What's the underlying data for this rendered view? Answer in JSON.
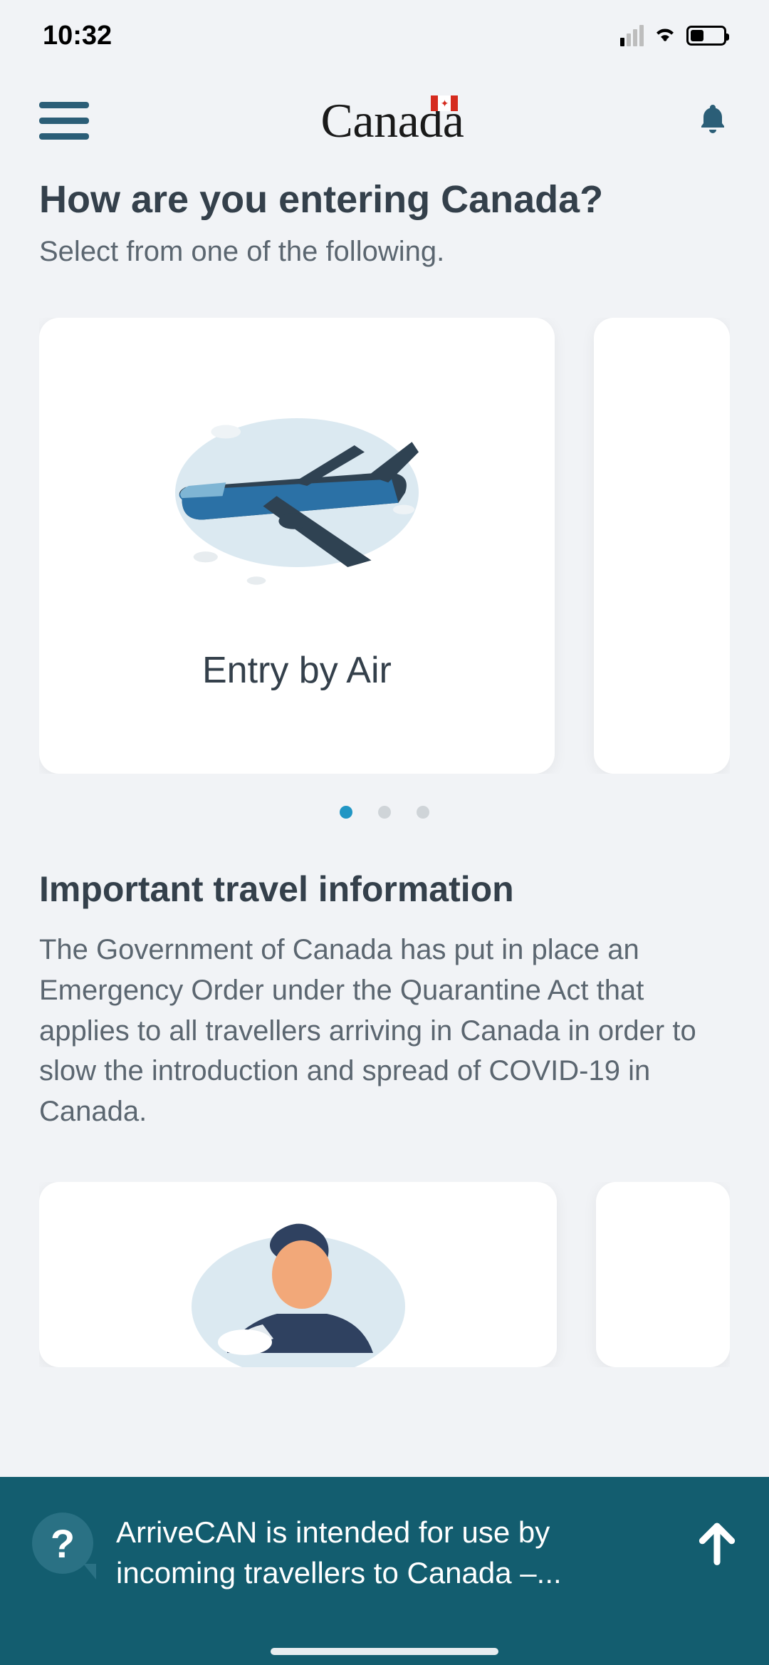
{
  "status": {
    "time": "10:32"
  },
  "header": {
    "wordmark": "Canada"
  },
  "question": {
    "title": "How are you entering Canada?",
    "subtitle": "Select from one of the following."
  },
  "entry_options": [
    {
      "label": "Entry by Air"
    }
  ],
  "carousel": {
    "total_dots": 3,
    "active_index": 0
  },
  "info": {
    "heading": "Important travel information",
    "body": "The Government of Canada has put in place an Emergency Order under the Quarantine Act that applies to all travellers arriving in Canada in order to slow the introduction and spread of COVID-19 in Canada."
  },
  "bottom": {
    "help_symbol": "?",
    "message": "ArriveCAN is intended for use by incoming travellers to Canada –..."
  }
}
